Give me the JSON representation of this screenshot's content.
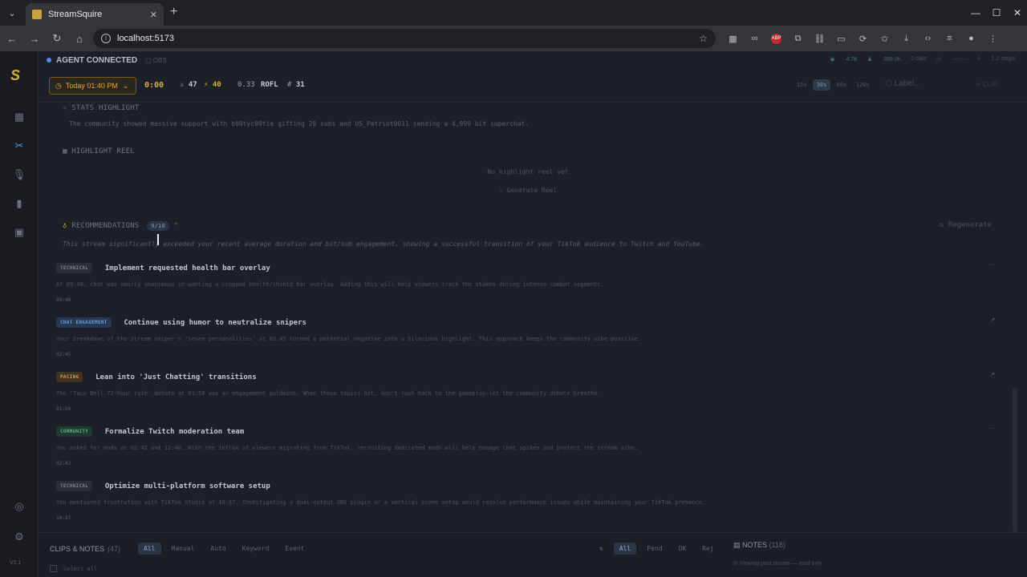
{
  "browser": {
    "tab_title": "StreamSquire",
    "url": "localhost:5173"
  },
  "status": {
    "agent": "AGENT CONNECTED",
    "obs": "OBS",
    "viewers": "4.7K",
    "followers": "389.3K",
    "clips": "0 clips",
    "clock": "--:--:--",
    "rate": "1.2 msg/s"
  },
  "controls": {
    "date": "Today 01:40 PM",
    "timer": "0:00",
    "count_a": "47",
    "count_b": "40",
    "ratio": "0.33",
    "rofl_label": "ROFL",
    "count_c": "31",
    "durations": [
      "15s",
      "30s",
      "60s",
      "120s"
    ],
    "active_duration": "30s",
    "label_placeholder": "Label...",
    "clip_label": "CLIP"
  },
  "sections": {
    "stats_title": "STATS HIGHLIGHT",
    "stats_text": "The community showed massive support with b00tyc00tie gifting 20 subs and US_Patriot0011 sending a 4,999 bit superchat.",
    "reel_title": "HIGHLIGHT REEL",
    "reel_empty": "No highlight reel yet",
    "reel_button": "Generate Reel",
    "rec_title": "RECOMMENDATIONS",
    "rec_count": "9/18",
    "regenerate": "Regenerate",
    "rec_summary": "This stream significantly exceeded your recent average duration and bit/sub engagement, showing a successful transition of your TikTok audience to Twitch and YouTube."
  },
  "recommendations": [
    {
      "category": "TECHNICAL",
      "title": "Implement requested health bar overlay",
      "desc": "At 09:40, chat was nearly unanimous in wanting a cropped health/shield bar overlay. Adding this will help viewers track the stakes during intense combat segments.",
      "time": "09:40"
    },
    {
      "category": "CHAT ENGAGEMENT",
      "title": "Continue using humor to neutralize snipers",
      "desc": "Your breakdown of the stream sniper's 'seven personalities' at 02:45 turned a potential negative into a hilarious highlight. This approach keeps the community vibe positive.",
      "time": "02:45"
    },
    {
      "category": "PACING",
      "title": "Lean into 'Just Chatting' transitions",
      "desc": "The 'Taco Bell 72-hour rule' debate at 01:50 was an engagement goldmine. When these topics hit, don't rush back to the gameplay—let the community debate breathe.",
      "time": "01:50"
    },
    {
      "category": "COMMUNITY",
      "title": "Formalize Twitch moderation team",
      "desc": "You asked for mods at 02:42 and 12:40. With the influx of viewers migrating from TikTok, recruiting dedicated mods will help manage chat spikes and protect the stream vibe.",
      "time": "02:42"
    },
    {
      "category": "TECHNICAL",
      "title": "Optimize multi-platform software setup",
      "desc": "You mentioned frustration with TikTok Studio at 10:37. Investigating a dual-output OBS plugin or a vertical scene setup would resolve performance issues while maintaining your TikTok presence.",
      "time": "10:37"
    }
  ],
  "bottom": {
    "clips_label": "CLIPS & NOTES",
    "clips_count": "(47)",
    "filters": [
      "All",
      "Manual",
      "Auto",
      "Keyword",
      "Event"
    ],
    "status_filters": [
      "All",
      "Pend",
      "OK",
      "Rej"
    ],
    "notes_label": "NOTES",
    "notes_count": "(118)",
    "readonly": "Viewing past stream — read only",
    "select_all": "Select all"
  },
  "app": {
    "version": "V0.1"
  },
  "colors": {
    "accent_blue": "#4f9dd6",
    "accent_gold": "#d7b13b"
  }
}
